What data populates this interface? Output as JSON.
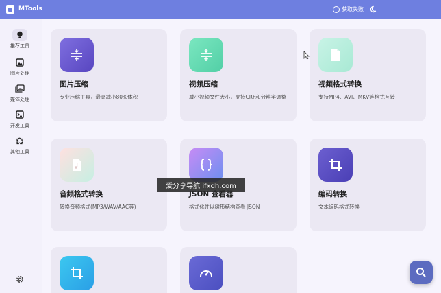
{
  "app": {
    "title": "MTools"
  },
  "header": {
    "fetch_status": "获取失败"
  },
  "sidebar": {
    "items": [
      {
        "label": "推荐工具",
        "icon": "lightbulb-icon",
        "active": true
      },
      {
        "label": "图片处理",
        "icon": "image-icon"
      },
      {
        "label": "媒体处理",
        "icon": "photos-icon"
      },
      {
        "label": "开发工具",
        "icon": "terminal-icon"
      },
      {
        "label": "其他工具",
        "icon": "puzzle-icon"
      }
    ],
    "settings_icon": "gear-icon"
  },
  "cards": [
    {
      "title": "图片压缩",
      "desc": "专业压缩工具，最高减小80%体积",
      "icon": "compress-icon",
      "color": "#6a5acd"
    },
    {
      "title": "视频压缩",
      "desc": "减小视频文件大小，支持CRF和分辨率调整",
      "icon": "compress-icon",
      "color": "#57d8a8"
    },
    {
      "title": "视频格式转换",
      "desc": "支持MP4、AVI、MKV等格式互转",
      "icon": "file-icon",
      "color": "#6ee0c6"
    },
    {
      "title": "音频格式转换",
      "desc": "转换音频格式(MP3/WAV/AAC等)",
      "icon": "audio-file-icon",
      "color": "#7fd8bf"
    },
    {
      "title": "JSON 查看器",
      "desc": "格式化并以树形结构查看 JSON",
      "icon": "braces-icon",
      "color": "#8b7cf6"
    },
    {
      "title": "编码转换",
      "desc": "文本编码格式转换",
      "icon": "crop-icon",
      "color": "#5b4fc4"
    },
    {
      "title": "",
      "desc": "",
      "icon": "crop-icon",
      "color": "#2aa8e8"
    },
    {
      "title": "",
      "desc": "",
      "icon": "speedometer-icon",
      "color": "#5a5bc7"
    }
  ],
  "watermark": "爱分享导航 ifxdh.com",
  "search_fab": {
    "icon": "search-icon"
  }
}
